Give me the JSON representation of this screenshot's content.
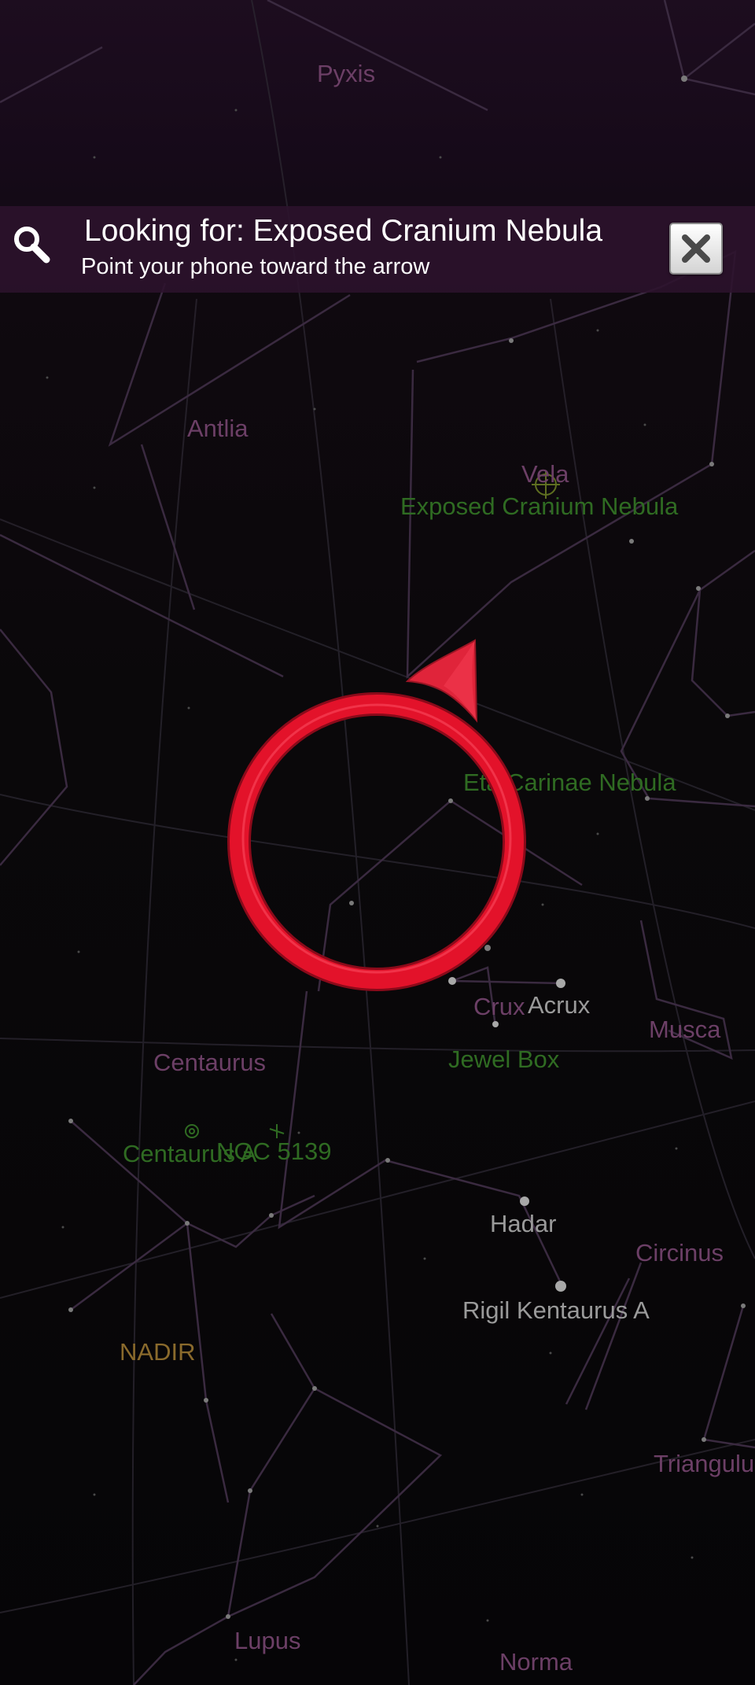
{
  "search": {
    "title": "Looking for: Exposed Cranium Nebula",
    "subtitle": "Point your phone toward the arrow",
    "search_icon": "search-icon",
    "close_icon": "close-icon"
  },
  "labels": {
    "pyxis": "Pyxis",
    "antlia": "Antlia",
    "vela": "Vela",
    "exposed_cranium": "Exposed Cranium Nebula",
    "eta_carinae": "Eta Carinae Nebula",
    "crux": "Crux",
    "acrux": "Acrux",
    "musca": "Musca",
    "jewel_box": "Jewel Box",
    "centaurus": "Centaurus",
    "centaurus_a": "Centaurus A",
    "ngc5139": "NGC 5139",
    "hadar": "Hadar",
    "circinus": "Circinus",
    "rigil": "Rigil Kentaurus A",
    "nadir": "NADIR",
    "triangulum": "Triangulu",
    "lupus": "Lupus",
    "norma": "Norma"
  },
  "colors": {
    "constellation_label": "#6c3f66",
    "constellation_line": "#3a2a40",
    "deep_sky_label": "#2f6b22",
    "star_label": "#9a9a9a",
    "nadir_label": "#8a6a2c",
    "target_ring": "#e3122a",
    "banner_background": "#2c122c"
  }
}
